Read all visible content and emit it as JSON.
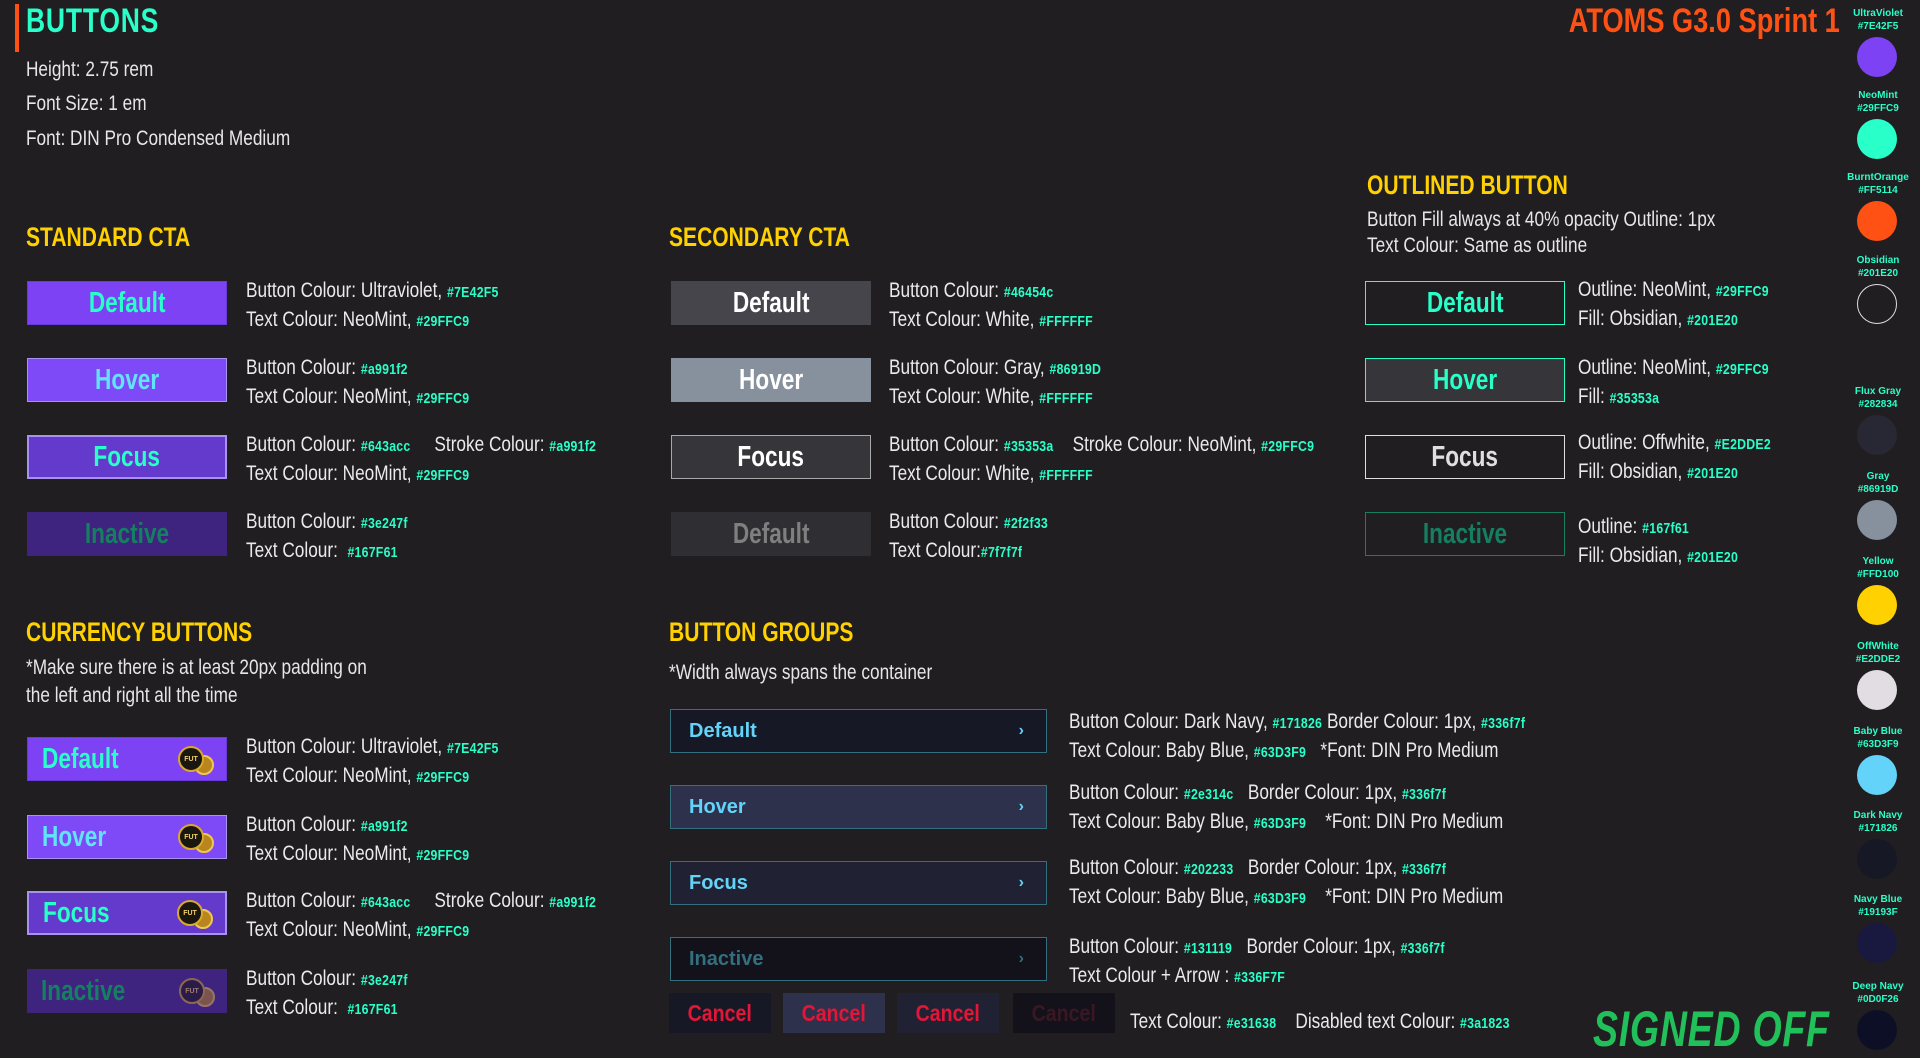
{
  "header": {
    "title": "BUTTONS",
    "height": "Height: 2.75 rem",
    "font_size": "Font Size: 1 em",
    "font": "Font: DIN Pro Condensed Medium",
    "sprint": "ATOMS G3.0 Sprint 1",
    "signed_off": "SIGNED OFF"
  },
  "standard": {
    "title": "STANDARD CTA",
    "buttons": [
      {
        "label": "Default",
        "l1": "Button Colour: Ultraviolet, ",
        "h1": "#7E42F5",
        "l2": "Text Colour: NeoMint, ",
        "h2": "#29FFC9"
      },
      {
        "label": "Hover",
        "l1": "Button Colour: ",
        "h1": "#a991f2",
        "l2": "Text Colour: NeoMint, ",
        "h2": "#29FFC9"
      },
      {
        "label": "Focus",
        "l1": "Button Colour: ",
        "h1": "#643acc",
        "l1b": "Stroke Colour: ",
        "h1b": "#a991f2",
        "l2": "Text Colour: NeoMint, ",
        "h2": "#29FFC9"
      },
      {
        "label": "Inactive",
        "l1": "Button Colour: ",
        "h1": "#3e247f",
        "l2": "Text Colour: ",
        "h2": "#167F61"
      }
    ]
  },
  "secondary": {
    "title": "SECONDARY CTA",
    "buttons": [
      {
        "label": "Default",
        "l1": "Button Colour: ",
        "h1": "#46454c",
        "l2": "Text Colour: White, ",
        "h2": "#FFFFFF"
      },
      {
        "label": "Hover",
        "l1": "Button Colour: Gray, ",
        "h1": "#86919D",
        "l2": "Text Colour: White, ",
        "h2": "#FFFFFF"
      },
      {
        "label": "Focus",
        "l1": "Button Colour: ",
        "h1": "#35353a",
        "l1b": "Stroke Colour: NeoMint, ",
        "h1b": "#29FFC9",
        "l2": "Text Colour: White, ",
        "h2": "#FFFFFF"
      },
      {
        "label": "Default",
        "l1": "Button Colour: ",
        "h1": "#2f2f33",
        "l2": "Text Colour:",
        "h2": "#7f7f7f"
      }
    ]
  },
  "outlined": {
    "title": "OUTLINED BUTTON",
    "note1": "Button Fill always at 40% opacity  Outline: 1px",
    "note2": "Text Colour: Same as outline",
    "buttons": [
      {
        "label": "Default",
        "l1": "Outline: NeoMint, ",
        "h1": "#29FFC9",
        "l2": "Fill: Obsidian, ",
        "h2": "#201E20"
      },
      {
        "label": "Hover",
        "l1": "Outline: NeoMint, ",
        "h1": "#29FFC9",
        "l2": "Fill: ",
        "h2": "#35353a"
      },
      {
        "label": "Focus",
        "l1": "Outline: Offwhite, ",
        "h1": "#E2DDE2",
        "l2": "Fill: Obsidian, ",
        "h2": "#201E20"
      },
      {
        "label": "Inactive",
        "l1": "Outline: ",
        "h1": "#167f61",
        "l2": "Fill: Obsidian, ",
        "h2": "#201E20"
      }
    ]
  },
  "currency": {
    "title": "CURRENCY BUTTONS",
    "note1": "*Make sure there is at least 20px padding on",
    "note2": "the left and right all the time",
    "coin_text": "FUT",
    "buttons": [
      {
        "label": "Default",
        "l1": "Button Colour: Ultraviolet, ",
        "h1": "#7E42F5",
        "l2": "Text Colour: NeoMint, ",
        "h2": "#29FFC9"
      },
      {
        "label": "Hover",
        "l1": "Button Colour: ",
        "h1": "#a991f2",
        "l2": "Text Colour: NeoMint, ",
        "h2": "#29FFC9"
      },
      {
        "label": "Focus",
        "l1": "Button Colour: ",
        "h1": "#643acc",
        "l1b": "Stroke Colour: ",
        "h1b": "#a991f2",
        "l2": "Text Colour: NeoMint, ",
        "h2": "#29FFC9"
      },
      {
        "label": "Inactive",
        "l1": "Button Colour: ",
        "h1": "#3e247f",
        "l2": "Text Colour: ",
        "h2": "#167F61"
      }
    ]
  },
  "groups": {
    "title": "BUTTON GROUPS",
    "note": "*Width always spans the container",
    "chevron": "›",
    "buttons": [
      {
        "label": "Default",
        "l1": "Button Colour: Dark Navy, ",
        "h1": "#171826",
        "l1b": "Border Colour: 1px, ",
        "h1b": "#336f7f",
        "l2": "Text Colour: Baby Blue, ",
        "h2": "#63D3F9",
        "l2b": "*Font: DIN Pro Medium"
      },
      {
        "label": "Hover",
        "l1": "Button Colour: ",
        "h1": "#2e314c",
        "l1b": "Border Colour: 1px, ",
        "h1b": "#336f7f",
        "l2": "Text Colour: Baby Blue, ",
        "h2": "#63D3F9",
        "l2b": "*Font: DIN Pro Medium"
      },
      {
        "label": "Focus",
        "l1": "Button Colour: ",
        "h1": "#202233",
        "l1b": "Border Colour: 1px, ",
        "h1b": "#336f7f",
        "l2": "Text Colour: Baby Blue, ",
        "h2": "#63D3F9",
        "l2b": "*Font: DIN Pro Medium"
      },
      {
        "label": "Inactive",
        "l1": "Button Colour: ",
        "h1": "#131119",
        "l1b": "Border Colour: 1px, ",
        "h1b": "#336f7f",
        "l2": "Text Colour + Arrow : ",
        "h2": "#336F7F"
      }
    ],
    "cancel": [
      "Cancel",
      "Cancel",
      "Cancel",
      "Cancel"
    ],
    "cancel_text": "Text Colour: ",
    "cancel_hex": "#e31638",
    "disabled_text": "Disabled text Colour: ",
    "disabled_hex": "#3a1823"
  },
  "swatches": [
    {
      "name": "UltraViolet",
      "hex": "#7E42F5"
    },
    {
      "name": "NeoMint",
      "hex": "#29FFC9"
    },
    {
      "name": "BurntOrange",
      "hex": "#FF5114"
    },
    {
      "name": "Obsidian",
      "hex": "#201E20"
    },
    {
      "name": "Flux Gray",
      "hex": "#282834"
    },
    {
      "name": "Gray",
      "hex": "#86919D"
    },
    {
      "name": "Yellow",
      "hex": "#FFD100"
    },
    {
      "name": "OffWhite",
      "hex": "#E2DDE2"
    },
    {
      "name": "Baby Blue",
      "hex": "#63D3F9"
    },
    {
      "name": "Dark Navy",
      "hex": "#171826"
    },
    {
      "name": "Navy Blue",
      "hex": "#19193F"
    },
    {
      "name": "Deep Navy",
      "hex": "#0D0F26"
    }
  ]
}
